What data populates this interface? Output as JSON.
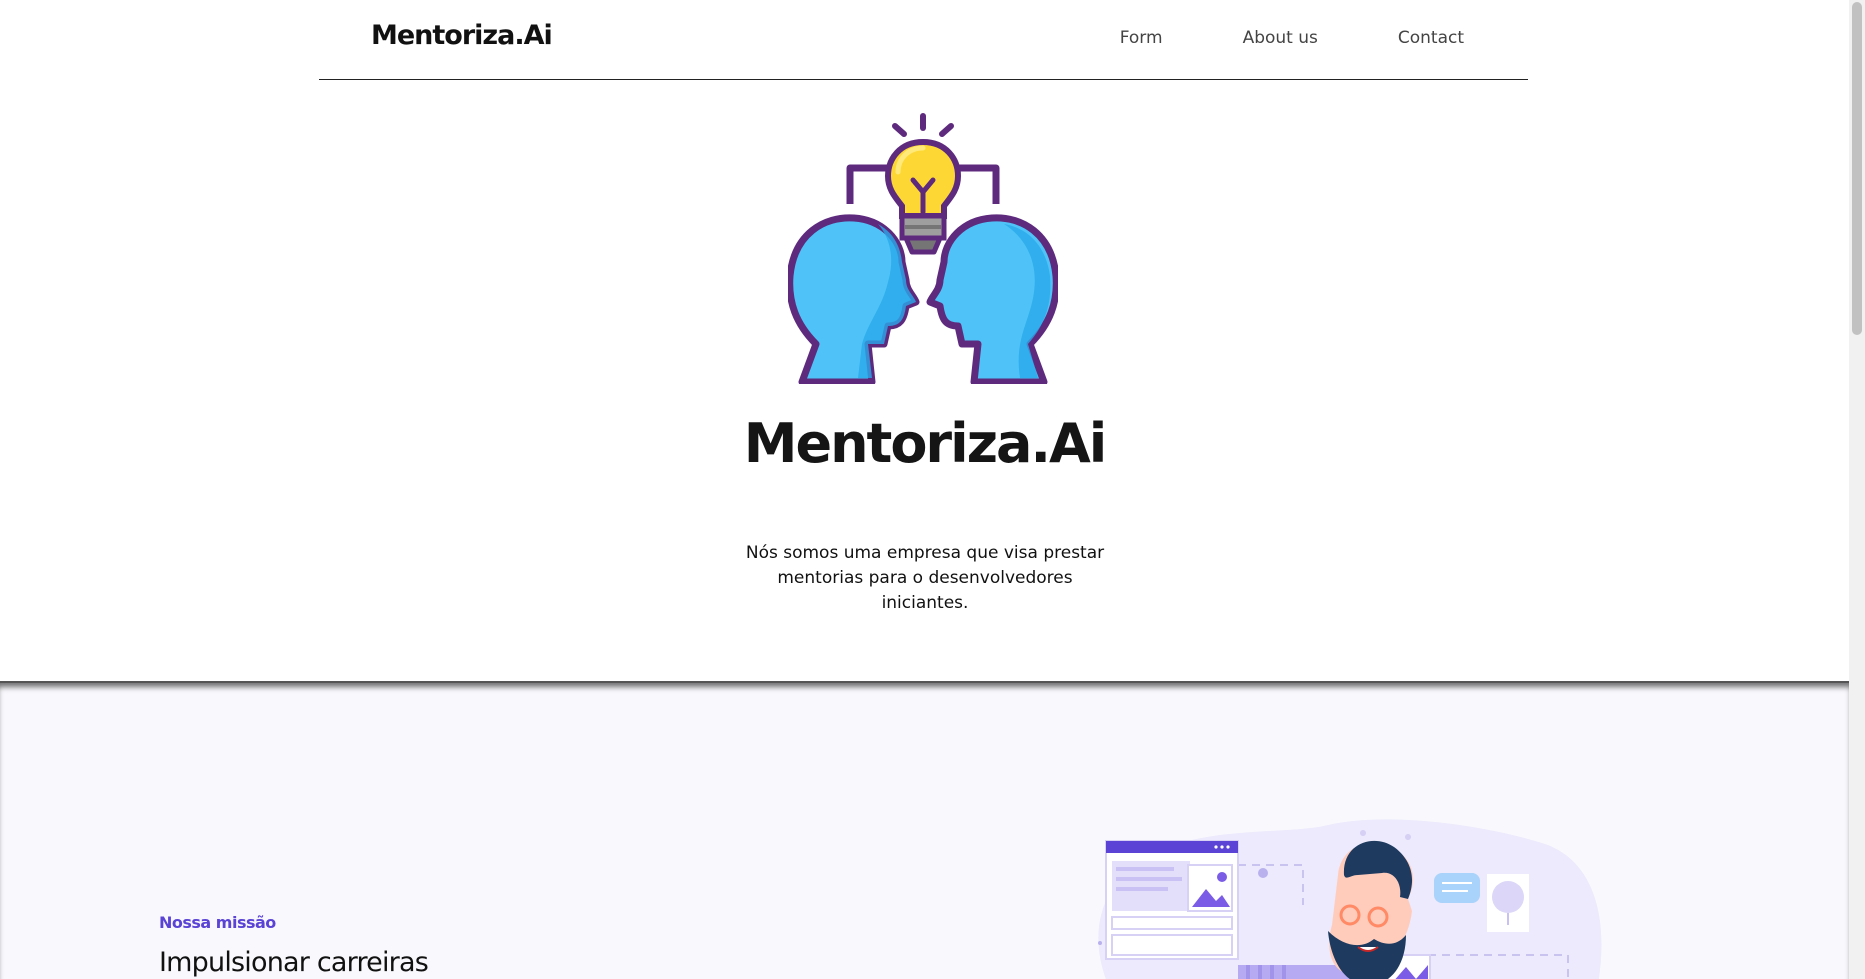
{
  "header": {
    "brand": "Mentoriza.Ai",
    "nav": [
      {
        "label": "Form"
      },
      {
        "label": "About us"
      },
      {
        "label": "Contact"
      }
    ]
  },
  "hero": {
    "illustration_icon": "two-heads-lightbulb-icon",
    "title": "Mentoriza.Ai",
    "description": "Nós somos uma empresa que visa prestar mentorias para o desenvolvedores iniciantes."
  },
  "mission": {
    "label": "Nossa missão",
    "title": "Impulsionar carreiras",
    "illustration_icon": "developer-with-windows-illustration"
  },
  "colors": {
    "accent": "#5b43d6",
    "head_blue": "#4fc3f7",
    "outline_purple": "#5e2a7e",
    "bulb_yellow": "#fdd835",
    "section_bg": "#f9f9fd"
  }
}
